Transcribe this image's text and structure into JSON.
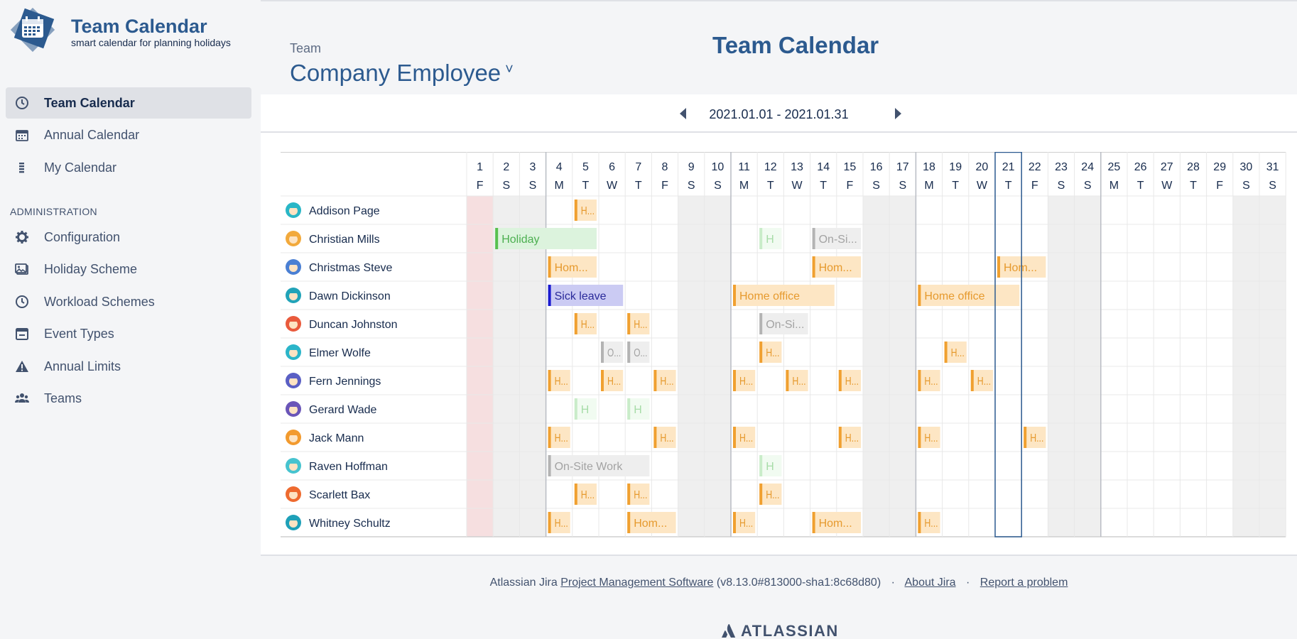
{
  "brand": {
    "title": "Team Calendar",
    "subtitle": "smart calendar for planning holidays"
  },
  "nav": [
    {
      "label": "Team Calendar",
      "icon": "clock-icon",
      "active": true
    },
    {
      "label": "Annual Calendar",
      "icon": "calendar-icon",
      "active": false
    },
    {
      "label": "My Calendar",
      "icon": "list-icon",
      "active": false
    }
  ],
  "admin": {
    "heading": "ADMINISTRATION",
    "items": [
      {
        "label": "Configuration",
        "icon": "gear-icon"
      },
      {
        "label": "Holiday Scheme",
        "icon": "image-icon"
      },
      {
        "label": "Workload Schemes",
        "icon": "clock-icon"
      },
      {
        "label": "Event Types",
        "icon": "event-calendar-icon"
      },
      {
        "label": "Annual Limits",
        "icon": "warning-icon"
      },
      {
        "label": "Teams",
        "icon": "users-icon"
      }
    ]
  },
  "header": {
    "team_label": "Team",
    "team_name": "Company Employee",
    "page_title": "Team Calendar",
    "date_range": "2021.01.01 - 2021.01.31"
  },
  "calendar": {
    "days": [
      {
        "d": "1",
        "w": "F"
      },
      {
        "d": "2",
        "w": "S"
      },
      {
        "d": "3",
        "w": "S"
      },
      {
        "d": "4",
        "w": "M"
      },
      {
        "d": "5",
        "w": "T"
      },
      {
        "d": "6",
        "w": "W"
      },
      {
        "d": "7",
        "w": "T"
      },
      {
        "d": "8",
        "w": "F"
      },
      {
        "d": "9",
        "w": "S"
      },
      {
        "d": "10",
        "w": "S"
      },
      {
        "d": "11",
        "w": "M"
      },
      {
        "d": "12",
        "w": "T"
      },
      {
        "d": "13",
        "w": "W"
      },
      {
        "d": "14",
        "w": "T"
      },
      {
        "d": "15",
        "w": "F"
      },
      {
        "d": "16",
        "w": "S"
      },
      {
        "d": "17",
        "w": "S"
      },
      {
        "d": "18",
        "w": "M"
      },
      {
        "d": "19",
        "w": "T"
      },
      {
        "d": "20",
        "w": "W"
      },
      {
        "d": "21",
        "w": "T"
      },
      {
        "d": "22",
        "w": "F"
      },
      {
        "d": "23",
        "w": "S"
      },
      {
        "d": "24",
        "w": "S"
      },
      {
        "d": "25",
        "w": "M"
      },
      {
        "d": "26",
        "w": "T"
      },
      {
        "d": "27",
        "w": "W"
      },
      {
        "d": "28",
        "w": "T"
      },
      {
        "d": "29",
        "w": "F"
      },
      {
        "d": "30",
        "w": "S"
      },
      {
        "d": "31",
        "w": "S"
      }
    ],
    "holiday_day": 1,
    "weekend_days": [
      2,
      3,
      9,
      10,
      16,
      17,
      23,
      24,
      30,
      31
    ],
    "week_start_days": [
      4,
      11,
      18,
      25
    ],
    "today_day": 21,
    "event_types": {
      "holiday": {
        "border": "#57c04e",
        "bg": "#dcf3dd",
        "text": "#4caf50"
      },
      "holiday_faint": {
        "border": "#c9ecc9",
        "bg": "#f1fbf1",
        "text": "#a7dca8"
      },
      "home": {
        "border": "#f0a030",
        "bg": "#fde6c4",
        "text": "#e69a2e"
      },
      "onsite": {
        "border": "#b3b3b3",
        "bg": "#eeeeee",
        "text": "#a3a3a3"
      },
      "sick": {
        "border": "#1a1acf",
        "bg": "#cbcbf3",
        "text": "#2a2a9a"
      }
    },
    "employees": [
      {
        "name": "Addison Page",
        "avatar": "#29b6c6",
        "events": [
          {
            "start": 5,
            "end": 5,
            "type": "home",
            "label": "H..."
          }
        ]
      },
      {
        "name": "Christian Mills",
        "avatar": "#f2a93b",
        "events": [
          {
            "start": 2,
            "end": 5,
            "type": "holiday",
            "label": "Holiday"
          },
          {
            "start": 12,
            "end": 12,
            "type": "holiday_faint",
            "label": "H"
          },
          {
            "start": 14,
            "end": 15,
            "type": "onsite",
            "label": "On-Si..."
          }
        ]
      },
      {
        "name": "Christmas Steve",
        "avatar": "#4a7fd3",
        "events": [
          {
            "start": 4,
            "end": 5,
            "type": "home",
            "label": "Hom..."
          },
          {
            "start": 14,
            "end": 15,
            "type": "home",
            "label": "Hom..."
          },
          {
            "start": 21,
            "end": 22,
            "type": "home",
            "label": "Hom..."
          }
        ]
      },
      {
        "name": "Dawn Dickinson",
        "avatar": "#21a3b8",
        "events": [
          {
            "start": 4,
            "end": 6,
            "type": "sick",
            "label": "Sick leave"
          },
          {
            "start": 11,
            "end": 14,
            "type": "home",
            "label": "Home office"
          },
          {
            "start": 18,
            "end": 21,
            "type": "home",
            "label": "Home office"
          }
        ]
      },
      {
        "name": "Duncan Johnston",
        "avatar": "#e95a3c",
        "events": [
          {
            "start": 5,
            "end": 5,
            "type": "home",
            "label": "H..."
          },
          {
            "start": 7,
            "end": 7,
            "type": "home",
            "label": "H..."
          },
          {
            "start": 12,
            "end": 13,
            "type": "onsite",
            "label": "On-Si..."
          }
        ]
      },
      {
        "name": "Elmer Wolfe",
        "avatar": "#2bb5c9",
        "events": [
          {
            "start": 6,
            "end": 6,
            "type": "onsite",
            "label": "O..."
          },
          {
            "start": 7,
            "end": 7,
            "type": "onsite",
            "label": "O..."
          },
          {
            "start": 12,
            "end": 12,
            "type": "home",
            "label": "H..."
          },
          {
            "start": 19,
            "end": 19,
            "type": "home",
            "label": "H..."
          }
        ]
      },
      {
        "name": "Fern Jennings",
        "avatar": "#5a5fc4",
        "events": [
          {
            "start": 4,
            "end": 4,
            "type": "home",
            "label": "H..."
          },
          {
            "start": 6,
            "end": 6,
            "type": "home",
            "label": "H..."
          },
          {
            "start": 8,
            "end": 8,
            "type": "home",
            "label": "H..."
          },
          {
            "start": 11,
            "end": 11,
            "type": "home",
            "label": "H..."
          },
          {
            "start": 13,
            "end": 13,
            "type": "home",
            "label": "H..."
          },
          {
            "start": 15,
            "end": 15,
            "type": "home",
            "label": "H..."
          },
          {
            "start": 18,
            "end": 18,
            "type": "home",
            "label": "H..."
          },
          {
            "start": 20,
            "end": 20,
            "type": "home",
            "label": "H..."
          }
        ]
      },
      {
        "name": "Gerard Wade",
        "avatar": "#6a55b8",
        "events": [
          {
            "start": 5,
            "end": 5,
            "type": "holiday_faint",
            "label": "H"
          },
          {
            "start": 7,
            "end": 7,
            "type": "holiday_faint",
            "label": "H"
          }
        ]
      },
      {
        "name": "Jack Mann",
        "avatar": "#f29a2e",
        "events": [
          {
            "start": 4,
            "end": 4,
            "type": "home",
            "label": "H..."
          },
          {
            "start": 8,
            "end": 8,
            "type": "home",
            "label": "H..."
          },
          {
            "start": 11,
            "end": 11,
            "type": "home",
            "label": "H..."
          },
          {
            "start": 15,
            "end": 15,
            "type": "home",
            "label": "H..."
          },
          {
            "start": 18,
            "end": 18,
            "type": "home",
            "label": "H..."
          },
          {
            "start": 22,
            "end": 22,
            "type": "home",
            "label": "H..."
          }
        ]
      },
      {
        "name": "Raven Hoffman",
        "avatar": "#46c3cf",
        "events": [
          {
            "start": 4,
            "end": 7,
            "type": "onsite",
            "label": "On-Site Work"
          },
          {
            "start": 12,
            "end": 12,
            "type": "holiday_faint",
            "label": "H"
          }
        ]
      },
      {
        "name": "Scarlett Bax",
        "avatar": "#ee6a2f",
        "events": [
          {
            "start": 5,
            "end": 5,
            "type": "home",
            "label": "H..."
          },
          {
            "start": 7,
            "end": 7,
            "type": "home",
            "label": "H..."
          },
          {
            "start": 12,
            "end": 12,
            "type": "home",
            "label": "H..."
          }
        ]
      },
      {
        "name": "Whitney Schultz",
        "avatar": "#1ea0b8",
        "events": [
          {
            "start": 4,
            "end": 4,
            "type": "home",
            "label": "H..."
          },
          {
            "start": 7,
            "end": 8,
            "type": "home",
            "label": "Hom..."
          },
          {
            "start": 11,
            "end": 11,
            "type": "home",
            "label": "H..."
          },
          {
            "start": 14,
            "end": 15,
            "type": "home",
            "label": "Hom..."
          },
          {
            "start": 18,
            "end": 18,
            "type": "home",
            "label": "H..."
          }
        ]
      }
    ]
  },
  "footer": {
    "prefix": "Atlassian Jira",
    "link1": "Project Management Software",
    "version": "(v8.13.0#813000-sha1:8c68d80)",
    "sep": "·",
    "link2": "About Jira",
    "link3": "Report a problem",
    "logo": "ATLASSIAN"
  }
}
